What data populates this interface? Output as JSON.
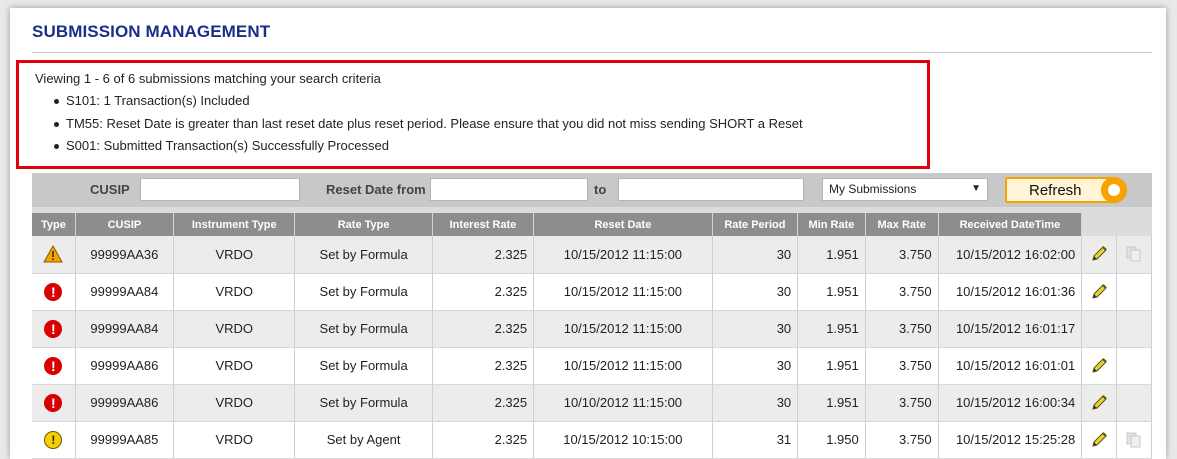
{
  "header": {
    "title": "SUBMISSION MANAGEMENT"
  },
  "messages": {
    "summary": "Viewing 1 - 6 of 6 submissions matching your search criteria",
    "items": [
      "S101: 1 Transaction(s) Included",
      "TM55: Reset Date is greater than last reset date plus reset period. Please ensure that you did not miss sending SHORT a Reset",
      "S001: Submitted Transaction(s) Successfully Processed"
    ],
    "border_color": "#e0000b"
  },
  "filter": {
    "cusip_label": "CUSIP",
    "cusip_value": "",
    "reset_from_label": "Reset Date from",
    "reset_from_value": "",
    "to_label": "to",
    "to_value": "",
    "scope_selected": "My Submissions",
    "refresh_label": "Refresh"
  },
  "table": {
    "columns": [
      "Type",
      "CUSIP",
      "Instrument Type",
      "Rate Type",
      "Interest Rate",
      "Reset Date",
      "Rate Period",
      "Min Rate",
      "Max Rate",
      "Received DateTime"
    ],
    "rows": [
      {
        "type_icon": "warning-icon",
        "cusip": "99999AA36",
        "instrument": "VRDO",
        "rate_type": "Set by Formula",
        "interest": "2.325",
        "reset_date": "10/15/2012 11:15:00",
        "period": "30",
        "min": "1.951",
        "max": "3.750",
        "received": "10/15/2012 16:02:00",
        "edit": true,
        "copy": true
      },
      {
        "type_icon": "error-icon",
        "cusip": "99999AA84",
        "instrument": "VRDO",
        "rate_type": "Set by Formula",
        "interest": "2.325",
        "reset_date": "10/15/2012 11:15:00",
        "period": "30",
        "min": "1.951",
        "max": "3.750",
        "received": "10/15/2012 16:01:36",
        "edit": true,
        "copy": false
      },
      {
        "type_icon": "error-icon",
        "cusip": "99999AA84",
        "instrument": "VRDO",
        "rate_type": "Set by Formula",
        "interest": "2.325",
        "reset_date": "10/15/2012 11:15:00",
        "period": "30",
        "min": "1.951",
        "max": "3.750",
        "received": "10/15/2012 16:01:17",
        "edit": false,
        "copy": false
      },
      {
        "type_icon": "error-icon",
        "cusip": "99999AA86",
        "instrument": "VRDO",
        "rate_type": "Set by Formula",
        "interest": "2.325",
        "reset_date": "10/15/2012 11:15:00",
        "period": "30",
        "min": "1.951",
        "max": "3.750",
        "received": "10/15/2012 16:01:01",
        "edit": true,
        "copy": false
      },
      {
        "type_icon": "error-icon",
        "cusip": "99999AA86",
        "instrument": "VRDO",
        "rate_type": "Set by Formula",
        "interest": "2.325",
        "reset_date": "10/10/2012 11:15:00",
        "period": "30",
        "min": "1.951",
        "max": "3.750",
        "received": "10/15/2012 16:00:34",
        "edit": true,
        "copy": false
      },
      {
        "type_icon": "info-icon",
        "cusip": "99999AA85",
        "instrument": "VRDO",
        "rate_type": "Set by Agent",
        "interest": "2.325",
        "reset_date": "10/15/2012 10:15:00",
        "period": "31",
        "min": "1.950",
        "max": "3.750",
        "received": "10/15/2012 15:25:28",
        "edit": true,
        "copy": true
      }
    ]
  },
  "colors": {
    "title": "#1a2f8a",
    "header_bg": "#8d8d8d",
    "refresh_accent": "#f5a300",
    "error": "#d80000",
    "warning": "#f5a300"
  }
}
